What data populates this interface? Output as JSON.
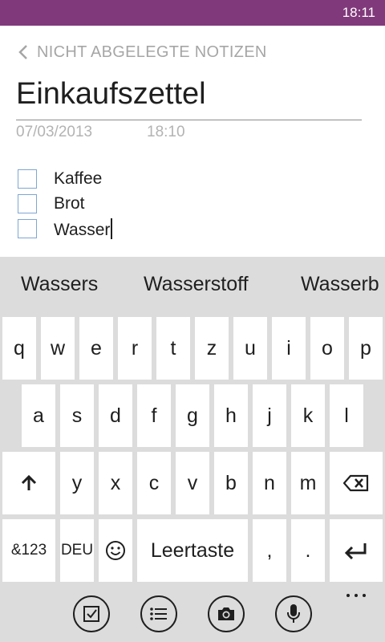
{
  "status": {
    "time": "18:11"
  },
  "colors": {
    "accent": "#80397b",
    "keyboard_bg": "#dcdcdc",
    "key_bg": "#ffffff",
    "checkbox_border": "#7ea6d2"
  },
  "nav": {
    "back_label": "NICHT ABGELEGTE NOTIZEN",
    "back_icon": "chevron-left-icon"
  },
  "note": {
    "title": "Einkaufszettel",
    "date": "07/03/2013",
    "time": "18:10",
    "items": [
      {
        "text": "Kaffee",
        "checked": false
      },
      {
        "text": "Brot",
        "checked": false
      },
      {
        "text": "Wasser",
        "checked": false
      }
    ]
  },
  "keyboard": {
    "suggestions": [
      "Wassers",
      "Wasserstoff",
      "Wasserb"
    ],
    "row1": [
      "q",
      "w",
      "e",
      "r",
      "t",
      "z",
      "u",
      "i",
      "o",
      "p"
    ],
    "row2": [
      "a",
      "s",
      "d",
      "f",
      "g",
      "h",
      "j",
      "k",
      "l"
    ],
    "row3": [
      "y",
      "x",
      "c",
      "v",
      "b",
      "n",
      "m"
    ],
    "symbols_label": "&123",
    "language_label": "DEU",
    "space_label": "Leertaste",
    "comma": ",",
    "period": ".",
    "icons": {
      "shift": "shift-icon",
      "backspace": "backspace-icon",
      "emoji": "emoji-icon",
      "enter": "enter-icon"
    }
  },
  "appbar": {
    "buttons": [
      "checklist-icon",
      "bullet-list-icon",
      "camera-icon",
      "microphone-icon"
    ],
    "more": "more-icon"
  }
}
